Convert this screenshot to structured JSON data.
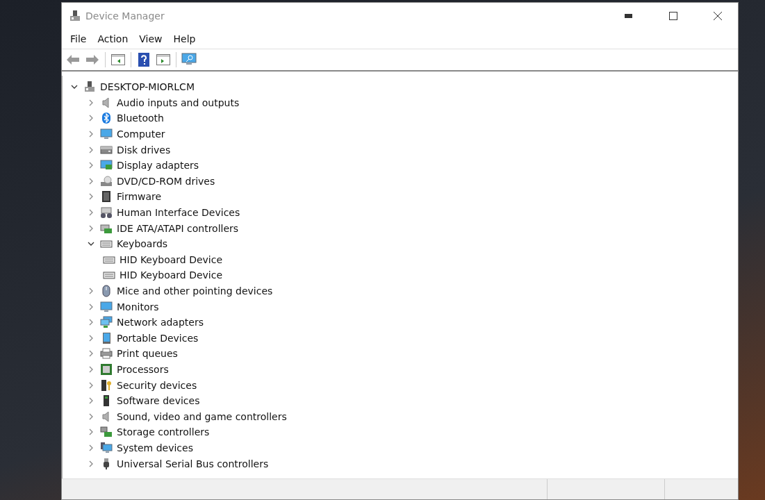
{
  "window": {
    "title": "Device Manager"
  },
  "menu": [
    "File",
    "Action",
    "View",
    "Help"
  ],
  "tree": {
    "label": "DESKTOP-MIORLCM",
    "expanded": true,
    "children": [
      {
        "label": "Audio inputs and outputs",
        "expanded": false
      },
      {
        "label": "Bluetooth",
        "expanded": false
      },
      {
        "label": "Computer",
        "expanded": false
      },
      {
        "label": "Disk drives",
        "expanded": false
      },
      {
        "label": "Display adapters",
        "expanded": false
      },
      {
        "label": "DVD/CD-ROM drives",
        "expanded": false
      },
      {
        "label": "Firmware",
        "expanded": false
      },
      {
        "label": "Human Interface Devices",
        "expanded": false
      },
      {
        "label": "IDE ATA/ATAPI controllers",
        "expanded": false
      },
      {
        "label": "Keyboards",
        "expanded": true,
        "children": [
          {
            "label": "HID Keyboard Device"
          },
          {
            "label": "HID Keyboard Device"
          }
        ]
      },
      {
        "label": "Mice and other pointing devices",
        "expanded": false
      },
      {
        "label": "Monitors",
        "expanded": false
      },
      {
        "label": "Network adapters",
        "expanded": false
      },
      {
        "label": "Portable Devices",
        "expanded": false
      },
      {
        "label": "Print queues",
        "expanded": false
      },
      {
        "label": "Processors",
        "expanded": false
      },
      {
        "label": "Security devices",
        "expanded": false
      },
      {
        "label": "Software devices",
        "expanded": false
      },
      {
        "label": "Sound, video and game controllers",
        "expanded": false
      },
      {
        "label": "Storage controllers",
        "expanded": false
      },
      {
        "label": "System devices",
        "expanded": false
      },
      {
        "label": "Universal Serial Bus controllers",
        "expanded": false
      }
    ]
  }
}
